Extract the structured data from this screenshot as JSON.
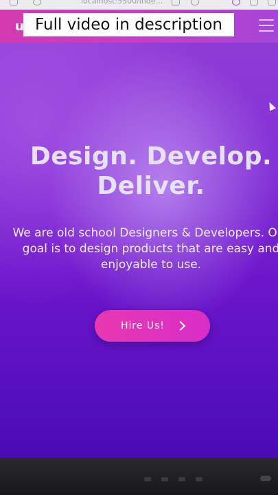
{
  "browser": {
    "url_fragment": "localhost:5500/inde..."
  },
  "header": {
    "logo_letter": "u"
  },
  "caption": {
    "text": "Full video in description"
  },
  "hero": {
    "title_line1": "Design. Develop.",
    "title_line2": "Deliver.",
    "desc_line1": "We are old school Designers & Developers. Our",
    "desc_line2": "goal is to design products that are easy and",
    "desc_line3": "enjoyable to use.",
    "cta_label": "Hire Us!"
  },
  "icons": {
    "menu": "hamburger-icon",
    "cta": "chevron-right-icon",
    "cursor": "mouse-cursor-icon"
  },
  "colors": {
    "header_pink": "#d43ab0",
    "hero_purple": "#7a24d0",
    "cta_pink": "#e838b0"
  }
}
